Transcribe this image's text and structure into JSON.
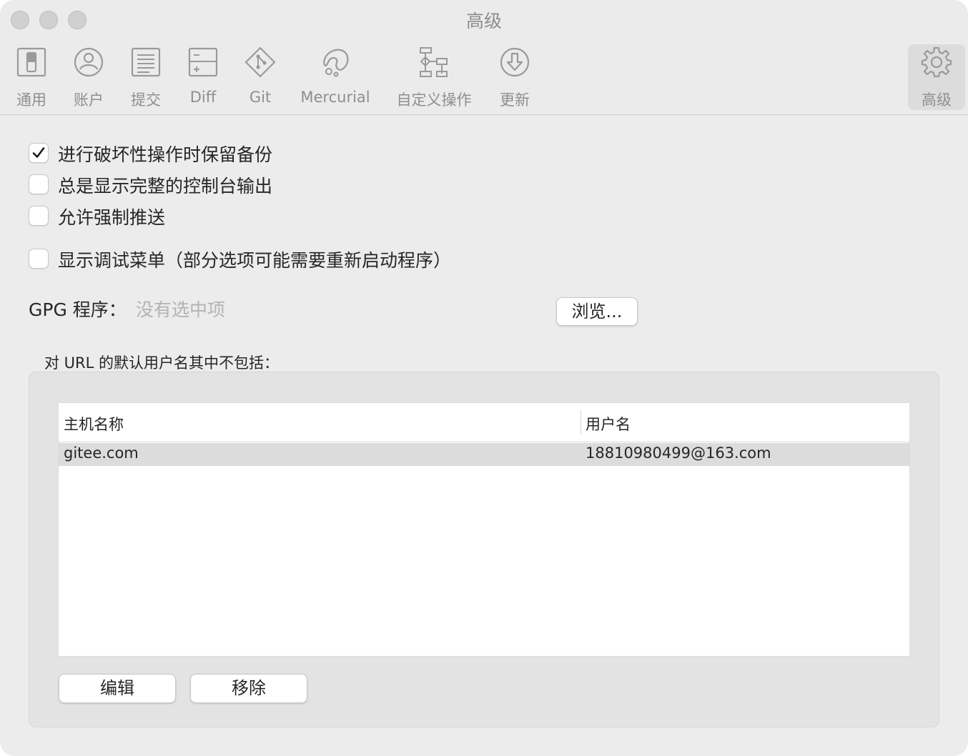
{
  "window": {
    "title": "高级"
  },
  "toolbar": {
    "items": [
      {
        "label": "通用",
        "icon": "switch-icon"
      },
      {
        "label": "账户",
        "icon": "user-circle-icon"
      },
      {
        "label": "提交",
        "icon": "document-lines-icon"
      },
      {
        "label": "Diff",
        "icon": "diff-icon"
      },
      {
        "label": "Git",
        "icon": "git-icon"
      },
      {
        "label": "Mercurial",
        "icon": "mercurial-icon"
      },
      {
        "label": "自定义操作",
        "icon": "flowchart-icon"
      },
      {
        "label": "更新",
        "icon": "download-circle-icon"
      },
      {
        "label": "高级",
        "icon": "gear-icon",
        "active": true
      }
    ]
  },
  "options": [
    {
      "label": "进行破坏性操作时保留备份",
      "checked": true
    },
    {
      "label": "总是显示完整的控制台输出",
      "checked": false
    },
    {
      "label": "允许强制推送",
      "checked": false
    },
    {
      "label": "显示调试菜单（部分选项可能需要重新启动程序）",
      "checked": false
    }
  ],
  "gpg": {
    "label": "GPG 程序：",
    "value": "没有选中项",
    "browse_label": "浏览..."
  },
  "url_section": {
    "label": "对 URL 的默认用户名其中不包括：",
    "columns": [
      "主机名称",
      "用户名"
    ],
    "rows": [
      {
        "host": "gitee.com",
        "username": "18810980499@163.com"
      }
    ],
    "edit_label": "编辑",
    "remove_label": "移除"
  },
  "colors": {
    "checkmark": "#1a1a1a",
    "selected_row": "#dcdcdc",
    "icon_gray": "#9a9a9a"
  }
}
